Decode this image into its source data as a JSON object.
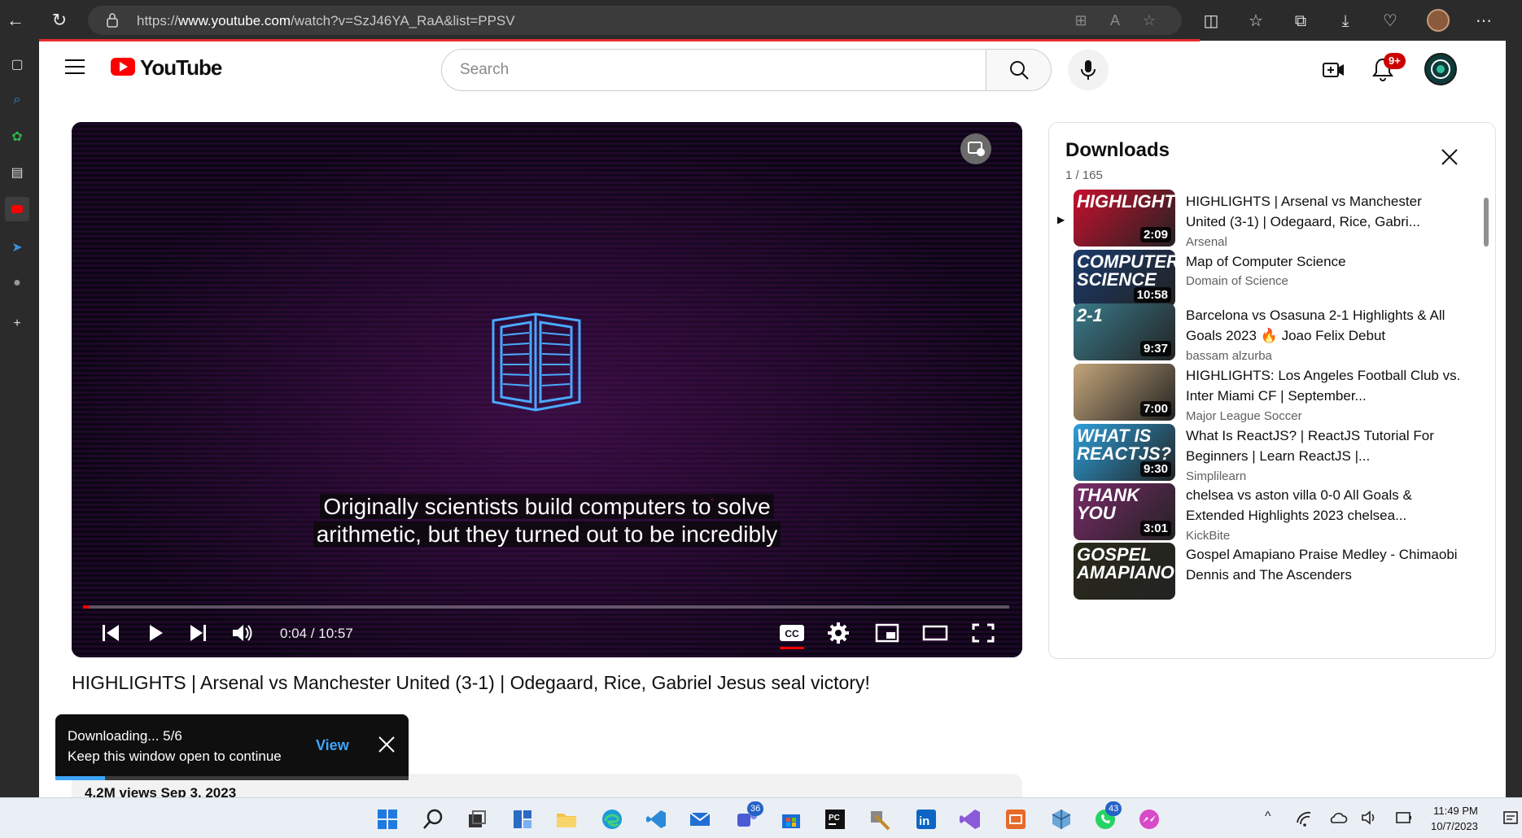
{
  "browser": {
    "url_prefix": "https://",
    "url_host": "www.youtube.com",
    "url_path": "/watch?v=SzJ46YA_RaA&list=PPSV"
  },
  "masthead": {
    "logo_text": "YouTube",
    "search_placeholder": "Search",
    "notification_count": "9+"
  },
  "player": {
    "caption_line1": "Originally scientists build computers to solve",
    "caption_line2": "arithmetic, but they turned out to be incredibly",
    "time": "0:04 / 10:57",
    "progress_fraction": 0.006
  },
  "video": {
    "title": "HIGHLIGHTS | Arsenal vs Manchester United (3-1) | Odegaard, Rice, Gabriel Jesus seal victory!",
    "views_date": "4.2M views  Sep 3, 2023"
  },
  "playlist": {
    "title": "Downloads",
    "count": "1 / 165",
    "items": [
      {
        "title": "HIGHLIGHTS | Arsenal vs Manchester United (3-1) | Odegaard, Rice, Gabri...",
        "channel": "Arsenal",
        "duration": "2:09",
        "thumb_text": "HIGHLIGHTS",
        "color": "#c8102e"
      },
      {
        "title": "Map of Computer Science",
        "channel": "Domain of Science",
        "duration": "10:58",
        "thumb_text": "COMPUTER SCIENCE",
        "color": "#1b3a6b"
      },
      {
        "title": "Barcelona vs Osasuna 2-1 Highlights & All Goals 2023 🔥 Joao Felix Debut",
        "channel": "bassam alzurba",
        "duration": "9:37",
        "thumb_text": "2-1",
        "color": "#3a7a8a"
      },
      {
        "title": "HIGHLIGHTS: Los Angeles Football Club vs. Inter Miami CF | September...",
        "channel": "Major League Soccer",
        "duration": "7:00",
        "thumb_text": "",
        "color": "#c4a57a"
      },
      {
        "title": "What Is ReactJS? | ReactJS Tutorial For Beginners | Learn ReactJS |...",
        "channel": "Simplilearn",
        "duration": "9:30",
        "thumb_text": "WHAT IS REACTJS?",
        "color": "#2d9fd9"
      },
      {
        "title": "chelsea vs aston villa 0-0 All Goals & Extended Highlights 2023 chelsea...",
        "channel": "KickBite",
        "duration": "3:01",
        "thumb_text": "THANK YOU",
        "color": "#7a2a6a"
      },
      {
        "title": "Gospel Amapiano Praise Medley - Chimaobi Dennis and The Ascenders",
        "channel": "",
        "duration": "",
        "thumb_text": "GOSPEL AMAPIANO",
        "color": "#2a2a1a"
      }
    ]
  },
  "toast": {
    "line1": "Downloading... 5/6",
    "line2": "Keep this window open to continue",
    "view_label": "View",
    "progress_fraction": 0.14
  },
  "taskbar": {
    "time": "11:49 PM",
    "date": "10/7/2023",
    "badge_teams": "36",
    "badge_whatsapp": "43"
  }
}
